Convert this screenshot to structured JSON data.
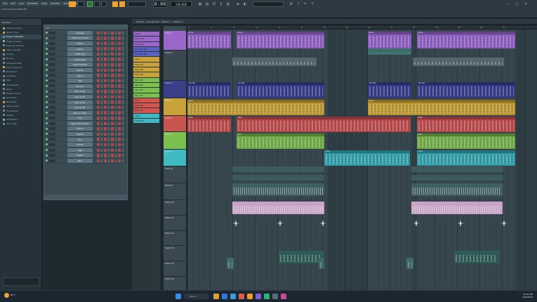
{
  "app": {
    "menus": [
      "FILE",
      "EDIT",
      "ADD",
      "PATTERNS",
      "VIEW",
      "OPTIONS",
      "TOOLS",
      "HELP"
    ],
    "song_info": "Cultural Groove Beat.flp",
    "time_display": "0:00",
    "tempo": "140.000"
  },
  "browser": {
    "title": "Browser",
    "items": [
      {
        "label": "Current project",
        "hl": false
      },
      {
        "label": "Recent files",
        "hl": false
      },
      {
        "label": "Plugin database",
        "hl": true
      },
      {
        "label": "Plugin presets",
        "hl": false
      },
      {
        "label": "Channel presets",
        "hl": false
      },
      {
        "label": "Mixer presets",
        "hl": false
      },
      {
        "label": "Scores",
        "hl": false
      },
      {
        "label": "Backup",
        "hl": false
      },
      {
        "label": "Clipboard files",
        "hl": false
      },
      {
        "label": "Demo projects",
        "hl": false
      },
      {
        "label": "Envelopes",
        "hl": false
      },
      {
        "label": "Impulses",
        "hl": false
      },
      {
        "label": "Misc",
        "hl": false
      },
      {
        "label": "My projects",
        "hl": false
      },
      {
        "label": "Packs",
        "hl": false
      },
      {
        "label": "Project bones",
        "hl": false
      },
      {
        "label": "Recorded",
        "hl": false
      },
      {
        "label": "Rendered",
        "hl": false
      },
      {
        "label": "Sliced audio",
        "hl": false
      },
      {
        "label": "Soundfonts",
        "hl": false
      },
      {
        "label": "Speech",
        "hl": false
      },
      {
        "label": "Templates",
        "hl": false
      },
      {
        "label": "User data",
        "hl": false
      }
    ]
  },
  "rack": {
    "title": "All",
    "channels": [
      "Vintage",
      "Marimba Grand",
      "Sytrus",
      "Sytrus",
      "FLEX Pad",
      "Synth Bass",
      "Bass Sylenth",
      "Sytrus",
      "Sytrus",
      "Tag",
      "Nexus 2",
      "Sytrus #2",
      "Sytrus #3",
      "Sytrus #4",
      "Sytrus #5",
      "Nexus 3 (Hi)",
      "Kick",
      "Sytrus Prod. Perc",
      "Sytrus",
      "Sytrus",
      "Rim",
      "Hi Hat",
      "Clap",
      "Shaker",
      "Perc"
    ]
  },
  "playlist": {
    "tabs": [
      "Playlist - Arrangement",
      "Pattern 1",
      "Pattern 2"
    ],
    "ruler": [
      "1",
      "5",
      "9",
      "13",
      "17",
      "21",
      "25",
      "29",
      "33",
      "37",
      "41",
      "45",
      "49",
      "53",
      "57"
    ],
    "patterns": [
      {
        "label": "Pluck",
        "color": "#9a66c9"
      },
      {
        "label": "Pluck #2",
        "color": "#9a66c9"
      },
      {
        "label": "Pluck #3",
        "color": "#9a66c9"
      },
      {
        "label": "Vox Pan #1",
        "color": "#5a63c4"
      },
      {
        "label": "Vox Pan #2",
        "color": "#5a63c4"
      },
      {
        "label": "Keys",
        "color": "#c9a33a"
      },
      {
        "label": "Keys #2",
        "color": "#c9a33a"
      },
      {
        "label": "Keys #3",
        "color": "#c9a33a"
      },
      {
        "label": "Keys #4",
        "color": "#c9a33a"
      },
      {
        "label": "Perc #1",
        "color": "#7bbf4e"
      },
      {
        "label": "Perc #2",
        "color": "#7bbf4e"
      },
      {
        "label": "Perc #3",
        "color": "#7bbf4e"
      },
      {
        "label": "Perc #4",
        "color": "#7bbf4e"
      },
      {
        "label": "Bass",
        "color": "#d5554e"
      },
      {
        "label": "Bass #2",
        "color": "#d5554e"
      },
      {
        "label": "Bass #3",
        "color": "#d5554e"
      },
      {
        "label": "Lead",
        "color": "#3fb9c2"
      },
      {
        "label": "Lead #2",
        "color": "#3fb9c2"
      }
    ],
    "tracks": [
      "Track 1",
      "Track 2",
      "Track 3",
      "Track 4",
      "Track 5",
      "Track 6",
      "Track 7",
      "Track 8",
      "Track 9",
      "Track 10",
      "Track 11",
      "Track 12",
      "Track 13",
      "Track 14",
      "Track 15",
      "Track 16",
      "Track 17"
    ],
    "clip_labels": {
      "pluck": "Pluck",
      "vox": "Vox Pan",
      "keys": "Keys",
      "bass": "Bass",
      "perc": "Perc",
      "lead": "Lead"
    }
  },
  "taskbar": {
    "weather": "81°F",
    "search_placeholder": "Search",
    "clock_time": "10:41 PM",
    "clock_date": "7/26/2024"
  }
}
